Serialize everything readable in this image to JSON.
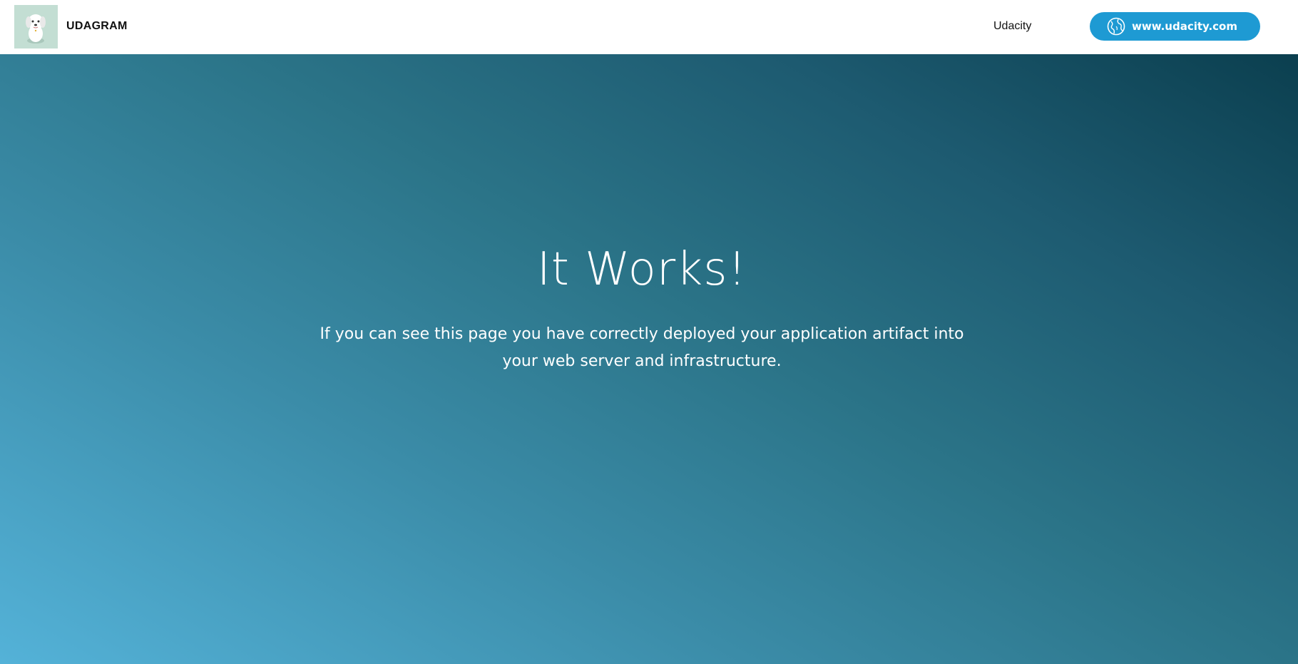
{
  "navbar": {
    "brand": "UDAGRAM",
    "link_label": "Udacity",
    "button_label": "www.udacity.com",
    "logo_icon": "dog-icon",
    "button_icon": "globe-icon",
    "background": "#ffffff",
    "button_color": "#1e9ad3"
  },
  "hero": {
    "title": "It Works!",
    "text": "If you can see this page you have correctly deployed your application artifact into your web server and infrastructure.",
    "gradient_colors": [
      "#54b2d8",
      "#2b7488",
      "#0b3f4f"
    ]
  }
}
